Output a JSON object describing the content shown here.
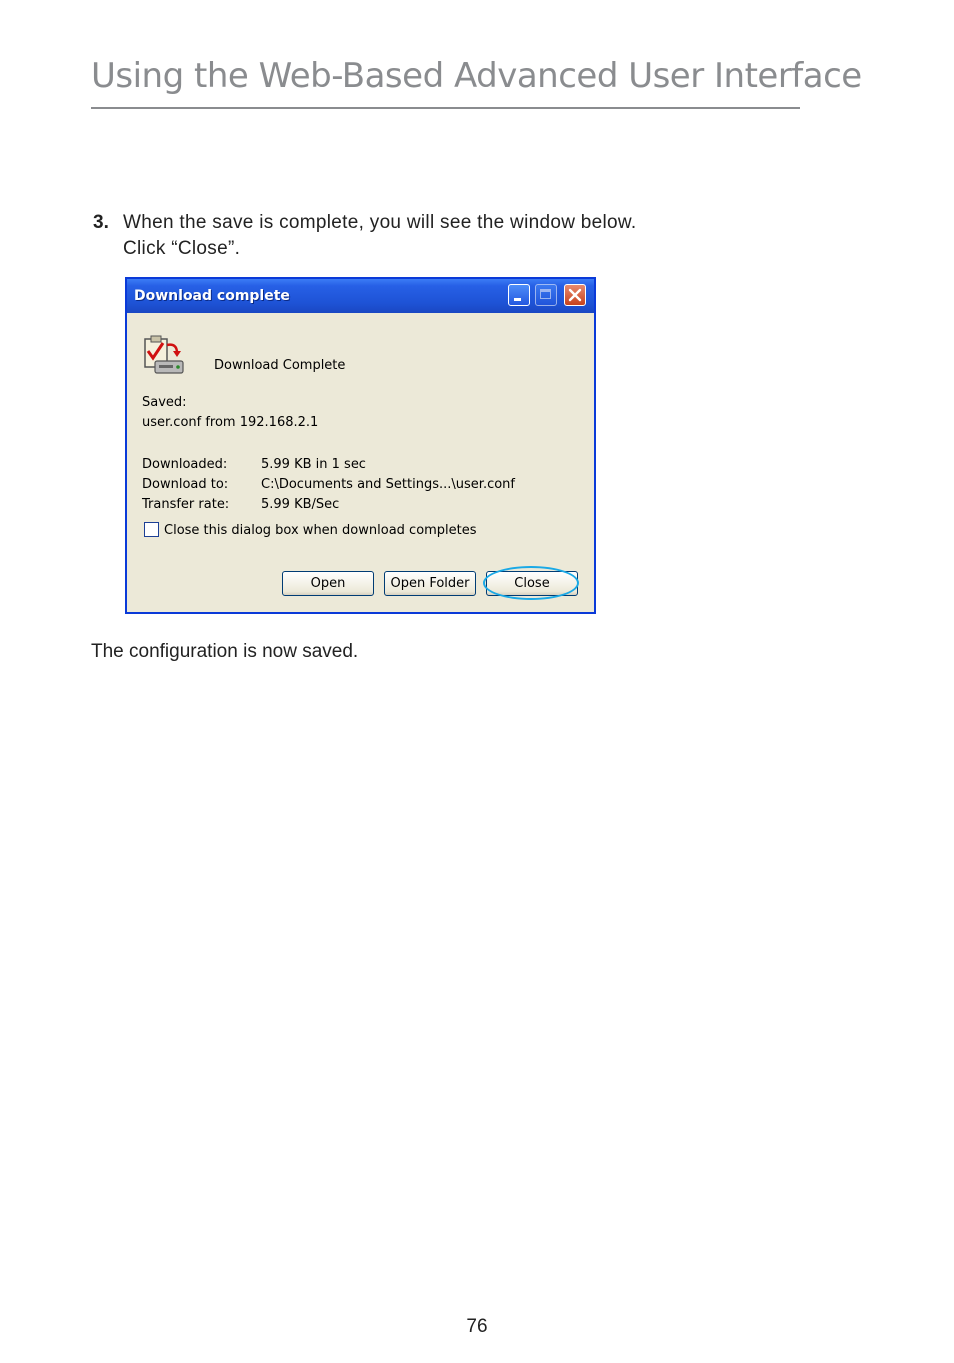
{
  "header": {
    "title": "Using the Web-Based Advanced User Interface"
  },
  "step": {
    "number": "3.",
    "line1": "When the save is complete, you will see the window below.",
    "line2": "Click “Close”."
  },
  "dialog": {
    "title": "Download complete",
    "heading": "Download Complete",
    "saved_label": "Saved:",
    "saved_value": "user.conf from 192.168.2.1",
    "rows": [
      {
        "label": "Downloaded:",
        "value": "5.99 KB in 1 sec"
      },
      {
        "label": "Download to:",
        "value": "C:\\Documents and Settings...\\user.conf"
      },
      {
        "label": "Transfer rate:",
        "value": "5.99 KB/Sec"
      }
    ],
    "checkbox_label": "Close this dialog box when download completes",
    "buttons": {
      "open": "Open",
      "open_folder": "Open Folder",
      "close": "Close"
    }
  },
  "after_text": "The configuration is now saved.",
  "page_number": "76",
  "colors": {
    "titlebar": "#2760e6",
    "dialog_bg": "#ece9d8",
    "highlight": "#1aa9e6",
    "header_gray": "#8a8c8f"
  }
}
